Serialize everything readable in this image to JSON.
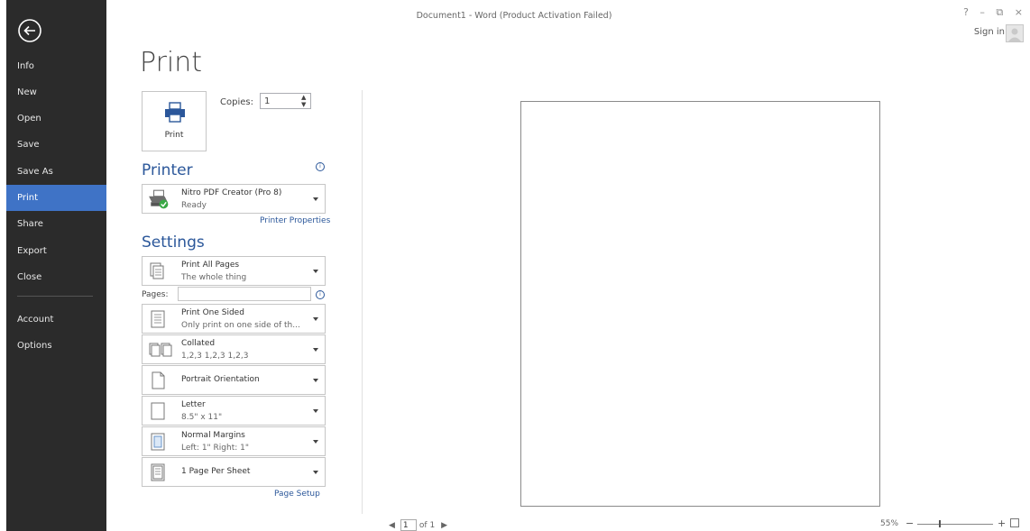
{
  "window": {
    "title": "Document1 - Word (Product Activation Failed)",
    "controls": [
      "?",
      "–",
      "⧉",
      "×"
    ],
    "signin": "Sign in"
  },
  "sidebar": {
    "items": [
      {
        "label": "Info"
      },
      {
        "label": "New"
      },
      {
        "label": "Open"
      },
      {
        "label": "Save"
      },
      {
        "label": "Save As"
      },
      {
        "label": "Print",
        "active": true
      },
      {
        "label": "Share"
      },
      {
        "label": "Export"
      },
      {
        "label": "Close"
      },
      {
        "label": "Account"
      },
      {
        "label": "Options"
      }
    ],
    "active_color": "#3f73c6"
  },
  "print": {
    "title": "Print",
    "button_label": "Print",
    "copies_label": "Copies:",
    "copies_value": "1"
  },
  "printer": {
    "heading": "Printer",
    "name": "Nitro PDF Creator (Pro 8)",
    "status": "Ready",
    "properties_link": "Printer Properties"
  },
  "settings": {
    "heading": "Settings",
    "pages_label": "Pages:",
    "range": {
      "title": "Print All Pages",
      "sub": "The whole thing"
    },
    "sides": {
      "title": "Print One Sided",
      "sub": "Only print on one side of th..."
    },
    "collation": {
      "title": "Collated",
      "sub": "1,2,3   1,2,3   1,2,3"
    },
    "orientation": {
      "title": "Portrait Orientation"
    },
    "paper": {
      "title": "Letter",
      "sub": "8.5\" x 11\""
    },
    "margins": {
      "title": "Normal Margins",
      "sub": "Left: 1\"   Right: 1\""
    },
    "per_sheet": {
      "title": "1 Page Per Sheet"
    },
    "page_setup_link": "Page Setup"
  },
  "preview": {
    "current_page": "1",
    "of_pages": "of 1",
    "zoom": "55%"
  }
}
